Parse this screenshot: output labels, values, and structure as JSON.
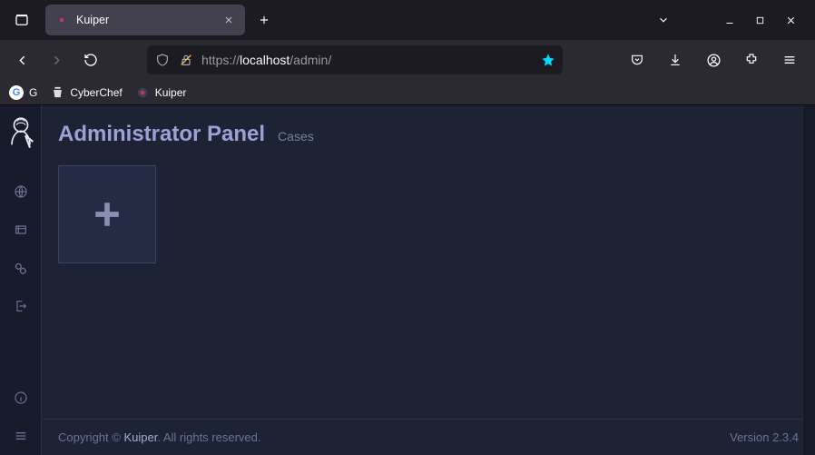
{
  "browser": {
    "tab_title": "Kuiper",
    "url_protocol": "https://",
    "url_host": "localhost",
    "url_path": "/admin/"
  },
  "bookmarks": [
    {
      "label": "G"
    },
    {
      "label": "CyberChef"
    },
    {
      "label": "Kuiper"
    }
  ],
  "page": {
    "title": "Administrator Panel",
    "subtitle": "Cases"
  },
  "footer": {
    "copyright_prefix": "Copyright © ",
    "brand": "Kuiper",
    "copyright_suffix": ". All rights reserved.",
    "version": "Version 2.3.4"
  }
}
